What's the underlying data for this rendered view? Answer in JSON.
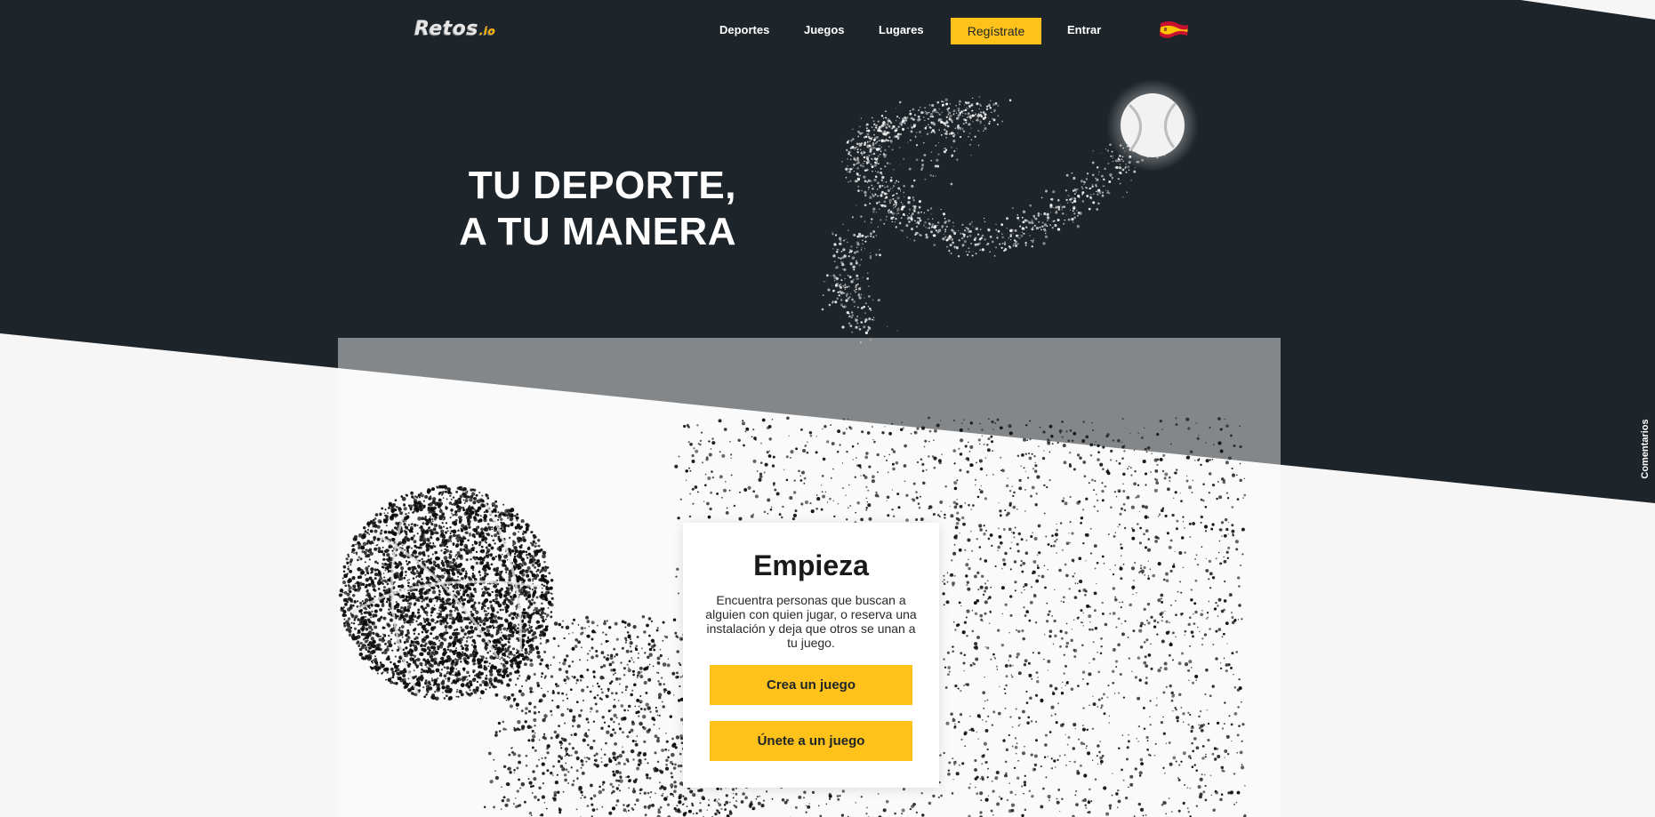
{
  "nav": {
    "logo_text": "Retos",
    "logo_suffix": ".io",
    "links": [
      "Deportes",
      "Juegos",
      "Lugares"
    ],
    "signup_label": "Regístrate",
    "login_label": "Entrar",
    "language_icon": "spain-flag-icon"
  },
  "hero": {
    "line1": "TU DEPORTE,",
    "line2": "A TU MANERA",
    "image": "tennis-ball-particles"
  },
  "start_card": {
    "title": "Empieza",
    "description": "Encuentra personas que buscan a alguien con quien jugar, o reserva una instalación y deja que otros se unan a tu juego.",
    "create_label": "Crea un juego",
    "join_label": "Únete a un juego",
    "image": "basketball-particles"
  },
  "feedback": {
    "label": "Comentarios"
  },
  "colors": {
    "dark_bg": "#1e252a",
    "light_bg": "#f6f6f6",
    "accent": "#ffc21b",
    "text_dark": "#1a1a1a",
    "white": "#ffffff"
  }
}
